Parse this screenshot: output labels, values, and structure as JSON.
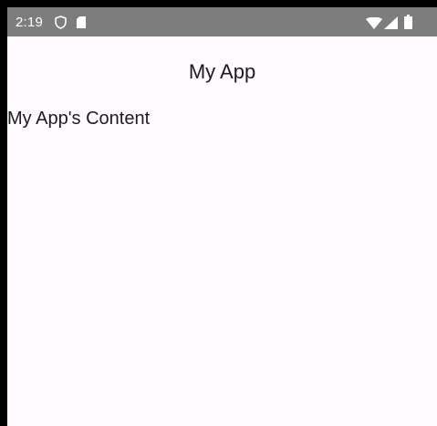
{
  "status_bar": {
    "time": "2:19",
    "icons": [
      "shield-icon",
      "sd-card-icon",
      "wifi-icon",
      "signal-icon",
      "battery-icon"
    ],
    "background_color": "#7d7d7d"
  },
  "app": {
    "title": "My App",
    "content_text": "My App's Content",
    "background_color": "#fffbfe"
  }
}
